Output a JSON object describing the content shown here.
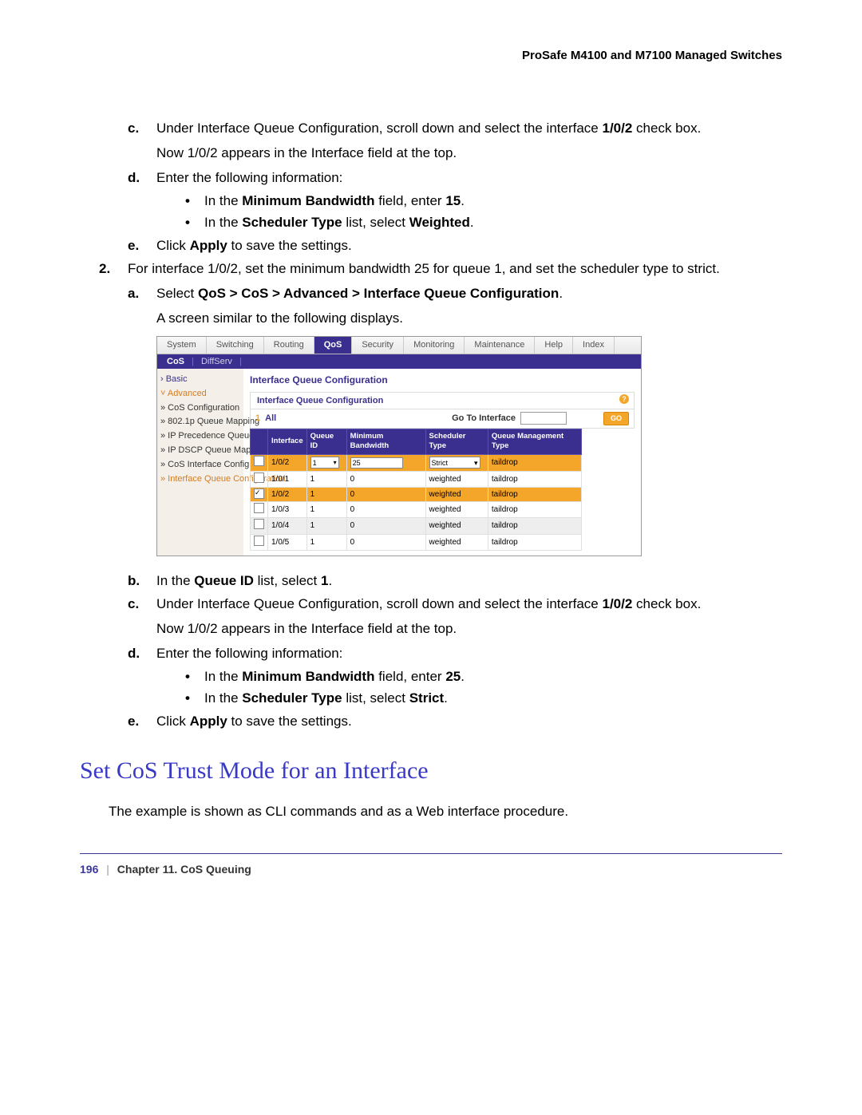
{
  "header": {
    "title": "ProSafe M4100 and M7100 Managed Switches"
  },
  "content": {
    "c1_pre": "Under Interface Queue Configuration, scroll down and select the interface ",
    "c1_bold": "1/0/2",
    "c1_post": " check box.",
    "c1_follow": "Now 1/0/2 appears in the Interface field at the top.",
    "d1": "Enter the following information:",
    "d1_bul1_pre": "In the ",
    "d1_bul1_b": "Minimum Bandwidth",
    "d1_bul1_mid": " field, enter ",
    "d1_bul1_b2": "15",
    "d1_bul1_post": ".",
    "d1_bul2_pre": "In the ",
    "d1_bul2_b": "Scheduler Type",
    "d1_bul2_mid": " list, select ",
    "d1_bul2_b2": "Weighted",
    "d1_bul2_post": ".",
    "e1_pre": "Click ",
    "e1_b": "Apply",
    "e1_post": " to save the settings.",
    "step2": "For interface 1/0/2, set the minimum bandwidth 25 for queue 1, and set the scheduler type to strict.",
    "a2_pre": "Select ",
    "a2_b": "QoS > CoS > Advanced > Interface Queue Configuration",
    "a2_post": ".",
    "a2_follow": "A screen similar to the following displays.",
    "b2_pre": "In the ",
    "b2_b": "Queue ID",
    "b2_mid": " list, select ",
    "b2_b2": "1",
    "b2_post": ".",
    "c2_pre": "Under Interface Queue Configuration, scroll down and select the interface ",
    "c2_b": "1/0/2",
    "c2_post": " check box.",
    "c2_follow": "Now 1/0/2 appears in the Interface field at the top.",
    "d2": "Enter the following information:",
    "d2_bul1_pre": "In the ",
    "d2_bul1_b": "Minimum Bandwidth",
    "d2_bul1_mid": " field, enter ",
    "d2_bul1_b2": "25",
    "d2_bul1_post": ".",
    "d2_bul2_pre": "In the ",
    "d2_bul2_b": "Scheduler Type",
    "d2_bul2_mid": " list, select ",
    "d2_bul2_b2": "Strict",
    "d2_bul2_post": ".",
    "e2_pre": "Click ",
    "e2_b": "Apply",
    "e2_post": " to save the settings."
  },
  "heading": "Set CoS Trust Mode for an Interface",
  "heading_follow": "The example is shown as CLI commands and as a Web interface procedure.",
  "footer": {
    "page": "196",
    "chapter": "Chapter 11.  CoS Queuing"
  },
  "shot": {
    "tabs": [
      "System",
      "Switching",
      "Routing",
      "QoS",
      "Security",
      "Monitoring",
      "Maintenance",
      "Help",
      "Index"
    ],
    "active_tab": "QoS",
    "subtabs": [
      "CoS",
      "DiffServ"
    ],
    "active_subtab": "CoS",
    "sidebar": [
      {
        "text": "Basic",
        "cls": "purple",
        "mark": "›"
      },
      {
        "text": "Advanced",
        "cls": "orange",
        "mark": "˅"
      },
      {
        "text": "CoS Configuration",
        "cls": "",
        "mark": "»"
      },
      {
        "text": "802.1p Queue Mapping",
        "cls": "",
        "mark": "»"
      },
      {
        "text": "IP Precedence Queue Mapping",
        "cls": "",
        "mark": "»"
      },
      {
        "text": "IP DSCP Queue Mapping",
        "cls": "",
        "mark": "»"
      },
      {
        "text": "CoS Interface Configuartion",
        "cls": "",
        "mark": "»"
      },
      {
        "text": "Interface Queue Configuration",
        "cls": "orange",
        "mark": "»"
      }
    ],
    "main_title": "Interface Queue Configuration",
    "sub_title": "Interface Queue Configuration",
    "filter_num": "1",
    "filter_all": "All",
    "goto_label": "Go To Interface",
    "go_btn": "GO",
    "columns": [
      "",
      "Interface",
      "Queue ID",
      "Minimum Bandwidth",
      "Scheduler Type",
      "Queue Management Type"
    ],
    "rows": [
      {
        "chk": false,
        "cls": "selrow",
        "iface": "1/0/2",
        "qid_sel": "1",
        "minbw_inp": "25",
        "sched_sel": "Strict",
        "qmgmt": "taildrop"
      },
      {
        "chk": false,
        "cls": "",
        "iface": "1/0/1",
        "qid": "1",
        "minbw": "0",
        "sched": "weighted",
        "qmgmt": "taildrop"
      },
      {
        "chk": true,
        "cls": "altsel",
        "iface": "1/0/2",
        "qid": "1",
        "minbw": "0",
        "sched": "weighted",
        "qmgmt": "taildrop"
      },
      {
        "chk": false,
        "cls": "",
        "iface": "1/0/3",
        "qid": "1",
        "minbw": "0",
        "sched": "weighted",
        "qmgmt": "taildrop"
      },
      {
        "chk": false,
        "cls": "alt",
        "iface": "1/0/4",
        "qid": "1",
        "minbw": "0",
        "sched": "weighted",
        "qmgmt": "taildrop"
      },
      {
        "chk": false,
        "cls": "",
        "iface": "1/0/5",
        "qid": "1",
        "minbw": "0",
        "sched": "weighted",
        "qmgmt": "taildrop"
      }
    ]
  }
}
